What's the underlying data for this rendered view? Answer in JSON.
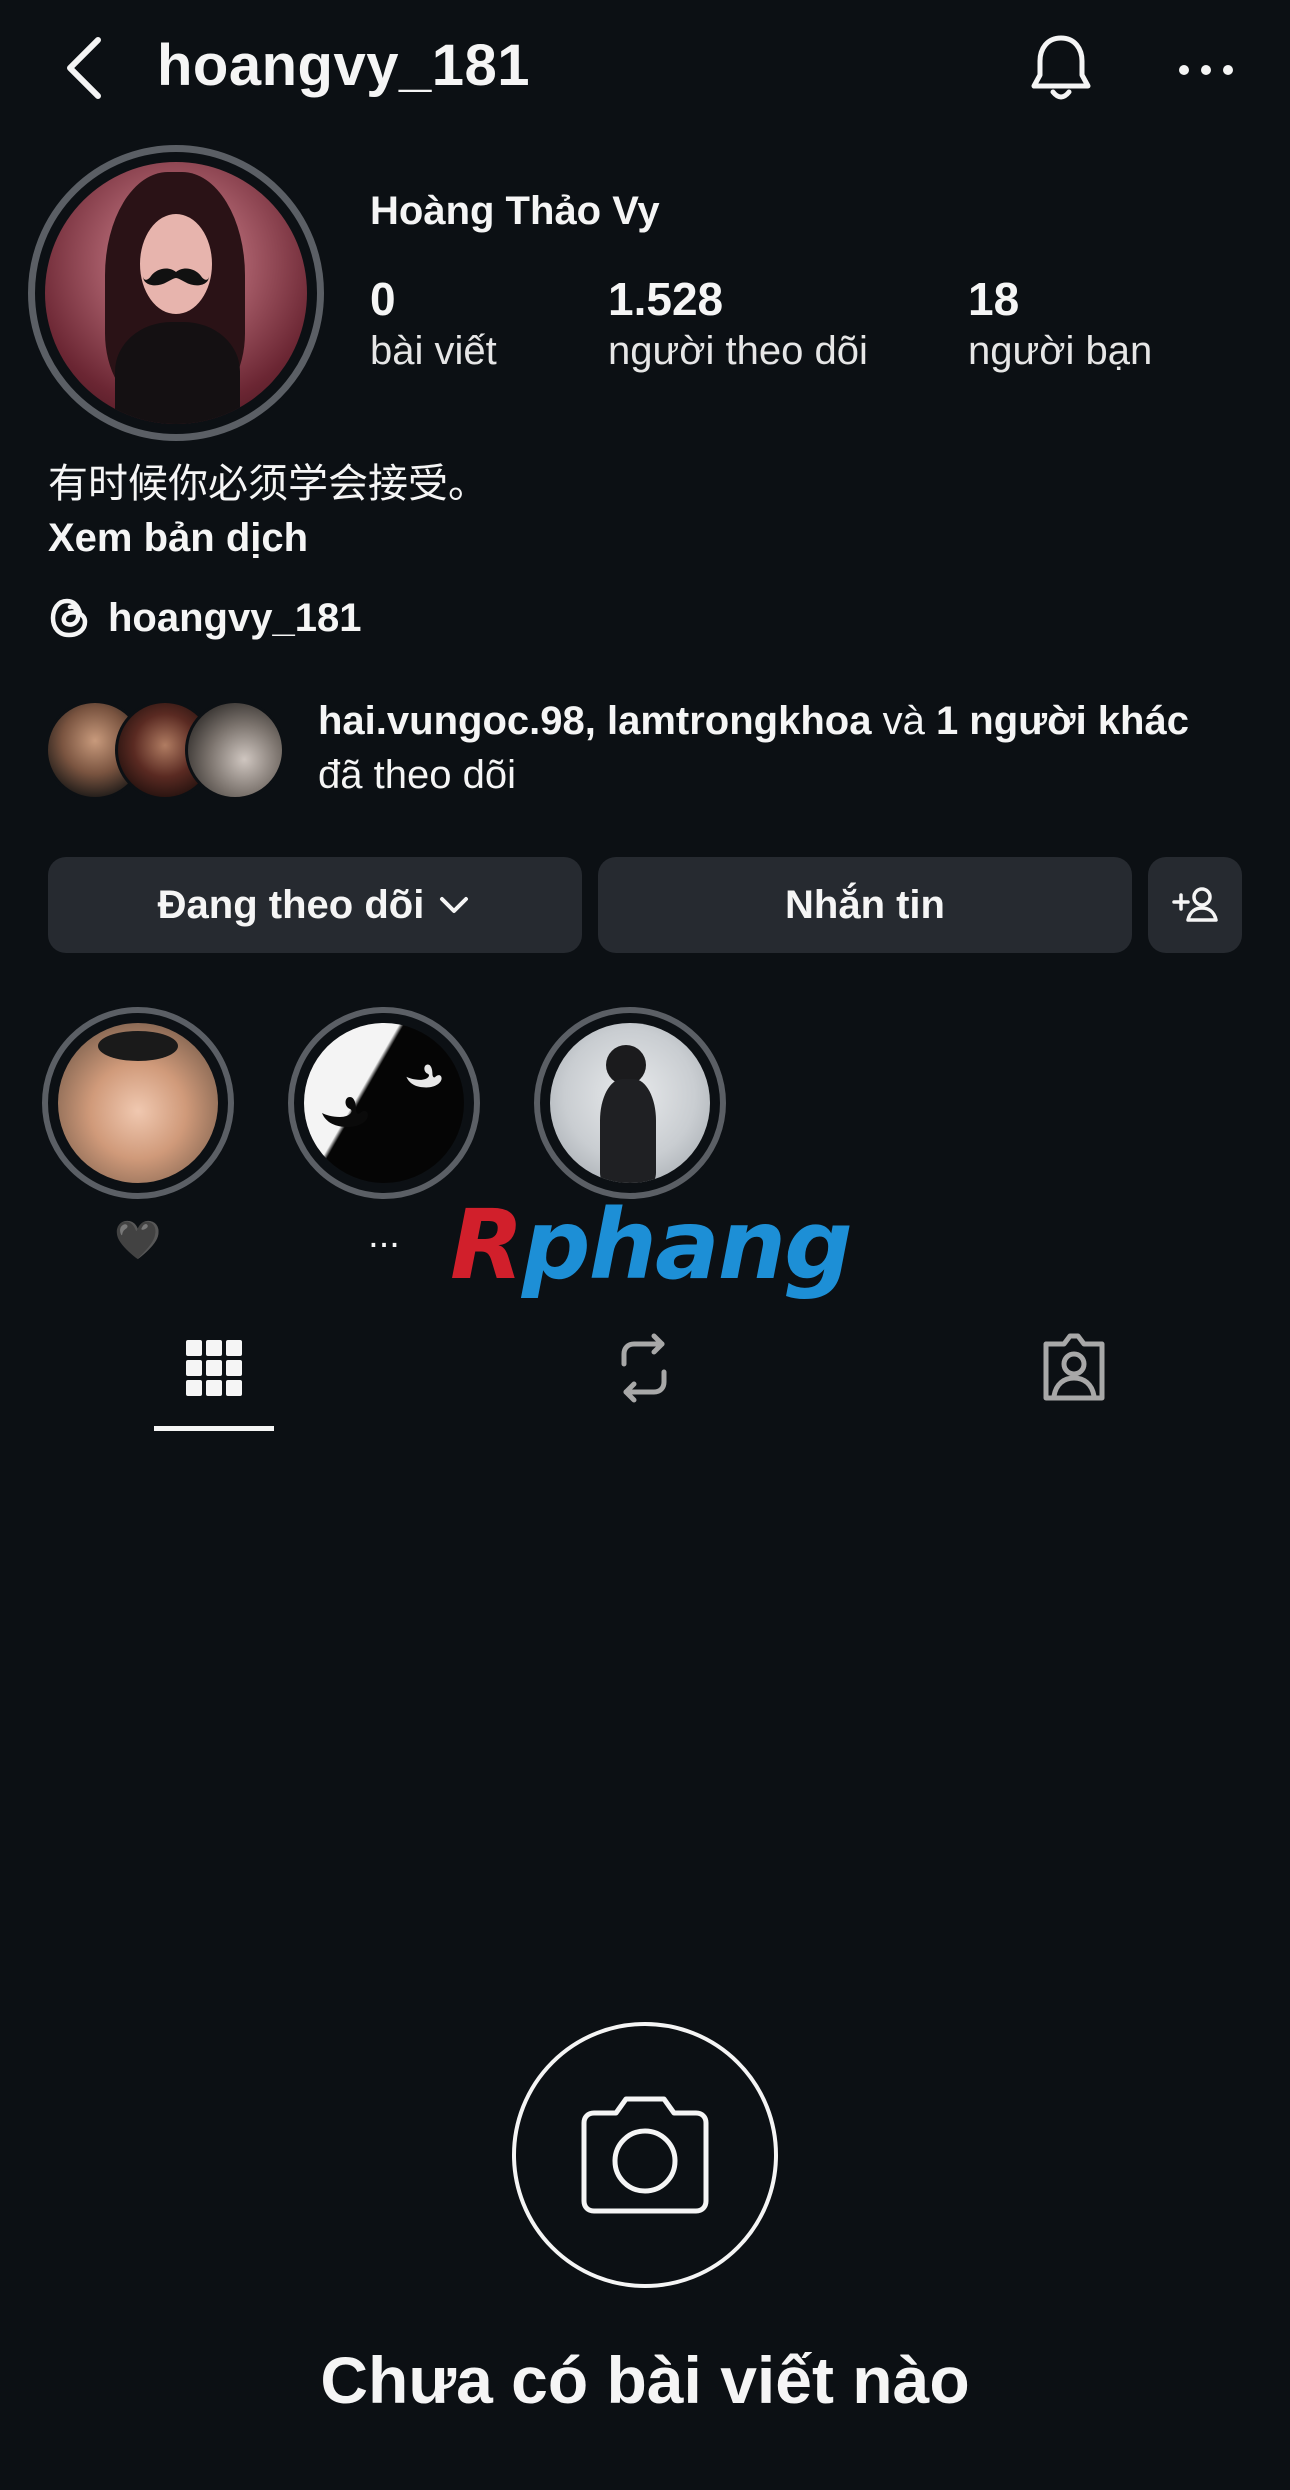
{
  "header": {
    "username": "hoangvy_181",
    "back_icon": "chevron-left-icon",
    "bell_icon": "bell-icon",
    "more_icon": "more-horizontal-icon"
  },
  "profile": {
    "display_name": "Hoàng Thảo Vy",
    "stats": [
      {
        "value": "0",
        "label": "bài viết"
      },
      {
        "value": "1.528",
        "label": "người theo dõi"
      },
      {
        "value": "18",
        "label": "người bạn"
      }
    ],
    "bio": "有时候你必须学会接受。",
    "translate_label": "Xem bản dịch",
    "threads_handle": "hoangvy_181"
  },
  "mutual": {
    "names": "hai.vungoc.98, lamtrongkhoa",
    "and_word": "và",
    "others": "1 người khác",
    "suffix": "đã theo dõi"
  },
  "actions": {
    "following_label": "Đang theo dõi",
    "message_label": "Nhắn tin",
    "add_friend_icon": "person-add-icon"
  },
  "highlights": [
    {
      "label": "🖤"
    },
    {
      "label": "..."
    },
    {
      "label": ""
    }
  ],
  "watermark": {
    "first": "R",
    "rest": "phang"
  },
  "tabs": [
    {
      "name": "grid",
      "icon": "grid-icon",
      "active": true
    },
    {
      "name": "reposts",
      "icon": "repost-icon",
      "active": false
    },
    {
      "name": "tagged",
      "icon": "tagged-person-icon",
      "active": false
    }
  ],
  "empty_state": {
    "icon": "camera-icon",
    "text": "Chưa có bài viết nào"
  },
  "colors": {
    "background": "#0c1014",
    "button": "#262a30",
    "text": "#f5f5f5",
    "ring": "#5b5f65"
  }
}
